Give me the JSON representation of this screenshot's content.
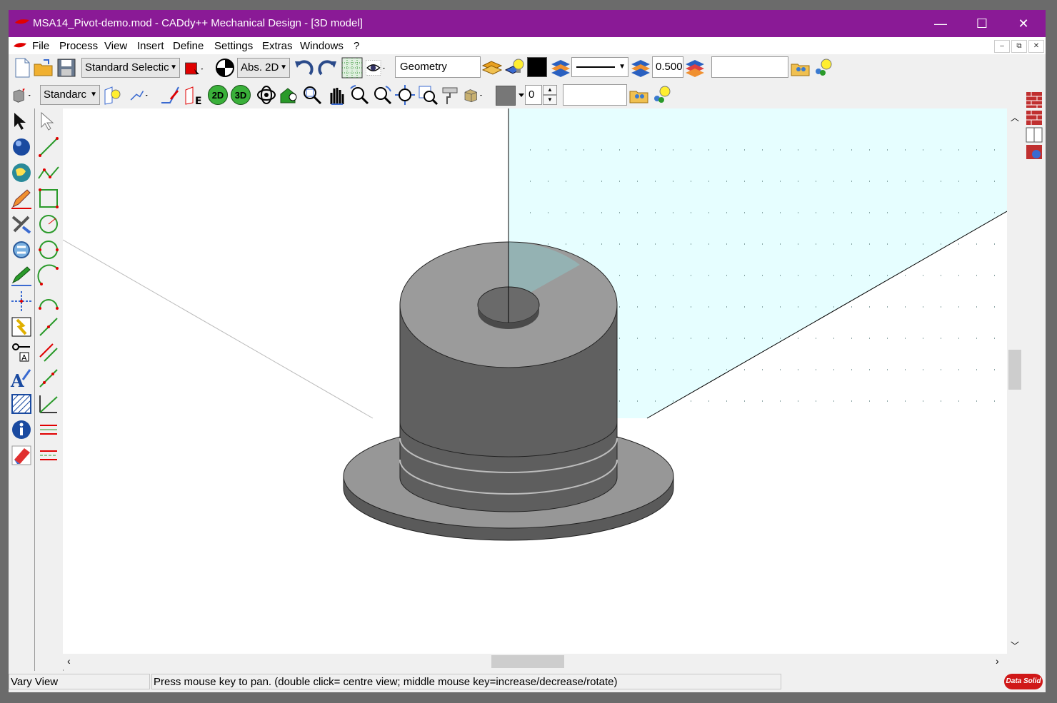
{
  "window": {
    "title": "MSA14_Pivot-demo.mod  -  CADdy++ Mechanical Design - [3D model]",
    "controls": {
      "minimize": "—",
      "maximize": "☐",
      "close": "✕"
    }
  },
  "menu": {
    "items": [
      "File",
      "Process",
      "View",
      "Insert",
      "Define",
      "Settings",
      "Extras",
      "Windows",
      "?"
    ],
    "mdi_controls": [
      "–",
      "⧉",
      "✕"
    ]
  },
  "toolbar1": {
    "selection_mode": "Standard Selectic",
    "coord_mode": "Abs. 2D",
    "layer_name": "Geometry",
    "line_width": "0.500",
    "color_swatch": "#000000",
    "pen_color": "#e00000",
    "search_value": ""
  },
  "toolbar2": {
    "view_style": "Standarc",
    "btn_2d": "2D",
    "btn_3d": "3D",
    "spin_value": "0",
    "search_value": ""
  },
  "status": {
    "mode": "Vary View",
    "hint": "Press mouse key to pan. (double click= centre view; middle mouse key=increase/decrease/rotate)",
    "logo": "Data Solid"
  },
  "colors": {
    "titlebar": "#8a1a96",
    "workplane": "#e6feff",
    "model_top": "#9a9a9a",
    "model_side": "#5e5e5e"
  }
}
